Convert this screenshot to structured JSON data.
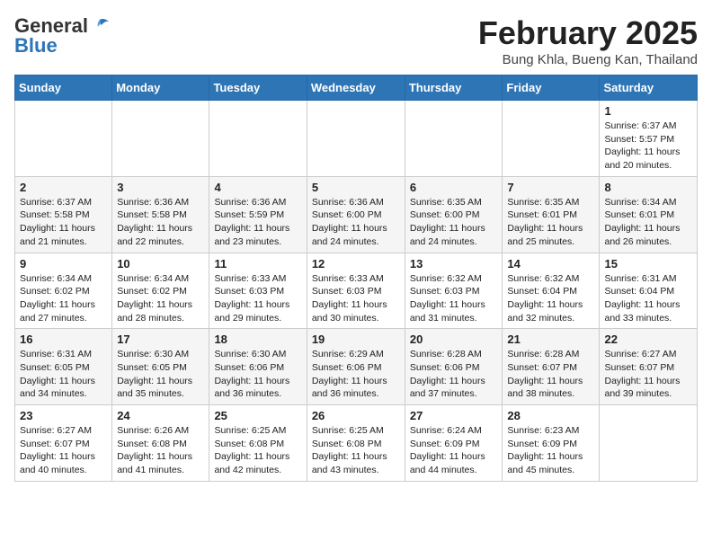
{
  "header": {
    "logo_general": "General",
    "logo_blue": "Blue",
    "month_title": "February 2025",
    "location": "Bung Khla, Bueng Kan, Thailand"
  },
  "days_of_week": [
    "Sunday",
    "Monday",
    "Tuesday",
    "Wednesday",
    "Thursday",
    "Friday",
    "Saturday"
  ],
  "weeks": [
    [
      {
        "day": "",
        "info": ""
      },
      {
        "day": "",
        "info": ""
      },
      {
        "day": "",
        "info": ""
      },
      {
        "day": "",
        "info": ""
      },
      {
        "day": "",
        "info": ""
      },
      {
        "day": "",
        "info": ""
      },
      {
        "day": "1",
        "info": "Sunrise: 6:37 AM\nSunset: 5:57 PM\nDaylight: 11 hours\nand 20 minutes."
      }
    ],
    [
      {
        "day": "2",
        "info": "Sunrise: 6:37 AM\nSunset: 5:58 PM\nDaylight: 11 hours\nand 21 minutes."
      },
      {
        "day": "3",
        "info": "Sunrise: 6:36 AM\nSunset: 5:58 PM\nDaylight: 11 hours\nand 22 minutes."
      },
      {
        "day": "4",
        "info": "Sunrise: 6:36 AM\nSunset: 5:59 PM\nDaylight: 11 hours\nand 23 minutes."
      },
      {
        "day": "5",
        "info": "Sunrise: 6:36 AM\nSunset: 6:00 PM\nDaylight: 11 hours\nand 24 minutes."
      },
      {
        "day": "6",
        "info": "Sunrise: 6:35 AM\nSunset: 6:00 PM\nDaylight: 11 hours\nand 24 minutes."
      },
      {
        "day": "7",
        "info": "Sunrise: 6:35 AM\nSunset: 6:01 PM\nDaylight: 11 hours\nand 25 minutes."
      },
      {
        "day": "8",
        "info": "Sunrise: 6:34 AM\nSunset: 6:01 PM\nDaylight: 11 hours\nand 26 minutes."
      }
    ],
    [
      {
        "day": "9",
        "info": "Sunrise: 6:34 AM\nSunset: 6:02 PM\nDaylight: 11 hours\nand 27 minutes."
      },
      {
        "day": "10",
        "info": "Sunrise: 6:34 AM\nSunset: 6:02 PM\nDaylight: 11 hours\nand 28 minutes."
      },
      {
        "day": "11",
        "info": "Sunrise: 6:33 AM\nSunset: 6:03 PM\nDaylight: 11 hours\nand 29 minutes."
      },
      {
        "day": "12",
        "info": "Sunrise: 6:33 AM\nSunset: 6:03 PM\nDaylight: 11 hours\nand 30 minutes."
      },
      {
        "day": "13",
        "info": "Sunrise: 6:32 AM\nSunset: 6:03 PM\nDaylight: 11 hours\nand 31 minutes."
      },
      {
        "day": "14",
        "info": "Sunrise: 6:32 AM\nSunset: 6:04 PM\nDaylight: 11 hours\nand 32 minutes."
      },
      {
        "day": "15",
        "info": "Sunrise: 6:31 AM\nSunset: 6:04 PM\nDaylight: 11 hours\nand 33 minutes."
      }
    ],
    [
      {
        "day": "16",
        "info": "Sunrise: 6:31 AM\nSunset: 6:05 PM\nDaylight: 11 hours\nand 34 minutes."
      },
      {
        "day": "17",
        "info": "Sunrise: 6:30 AM\nSunset: 6:05 PM\nDaylight: 11 hours\nand 35 minutes."
      },
      {
        "day": "18",
        "info": "Sunrise: 6:30 AM\nSunset: 6:06 PM\nDaylight: 11 hours\nand 36 minutes."
      },
      {
        "day": "19",
        "info": "Sunrise: 6:29 AM\nSunset: 6:06 PM\nDaylight: 11 hours\nand 36 minutes."
      },
      {
        "day": "20",
        "info": "Sunrise: 6:28 AM\nSunset: 6:06 PM\nDaylight: 11 hours\nand 37 minutes."
      },
      {
        "day": "21",
        "info": "Sunrise: 6:28 AM\nSunset: 6:07 PM\nDaylight: 11 hours\nand 38 minutes."
      },
      {
        "day": "22",
        "info": "Sunrise: 6:27 AM\nSunset: 6:07 PM\nDaylight: 11 hours\nand 39 minutes."
      }
    ],
    [
      {
        "day": "23",
        "info": "Sunrise: 6:27 AM\nSunset: 6:07 PM\nDaylight: 11 hours\nand 40 minutes."
      },
      {
        "day": "24",
        "info": "Sunrise: 6:26 AM\nSunset: 6:08 PM\nDaylight: 11 hours\nand 41 minutes."
      },
      {
        "day": "25",
        "info": "Sunrise: 6:25 AM\nSunset: 6:08 PM\nDaylight: 11 hours\nand 42 minutes."
      },
      {
        "day": "26",
        "info": "Sunrise: 6:25 AM\nSunset: 6:08 PM\nDaylight: 11 hours\nand 43 minutes."
      },
      {
        "day": "27",
        "info": "Sunrise: 6:24 AM\nSunset: 6:09 PM\nDaylight: 11 hours\nand 44 minutes."
      },
      {
        "day": "28",
        "info": "Sunrise: 6:23 AM\nSunset: 6:09 PM\nDaylight: 11 hours\nand 45 minutes."
      },
      {
        "day": "",
        "info": ""
      }
    ]
  ]
}
